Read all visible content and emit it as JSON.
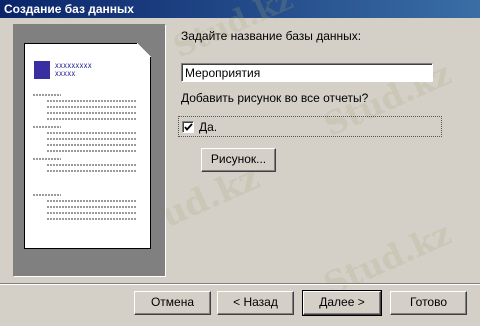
{
  "window": {
    "title": "Создание баз данных"
  },
  "preview": {
    "header_line1": "XXXXXXXXX",
    "header_line2": "XXXXX"
  },
  "form": {
    "name_prompt": "Задайте название базы данных:",
    "name_value": "Мероприятия",
    "picture_prompt": "Добавить рисунок во все отчеты?",
    "checkbox_label": "Да.",
    "checkbox_checked": true,
    "picture_button": "Рисунок..."
  },
  "buttons": {
    "cancel": "Отмена",
    "back": "< Назад",
    "next": "Далее >",
    "finish": "Готово"
  },
  "watermark": "Stud.kz"
}
